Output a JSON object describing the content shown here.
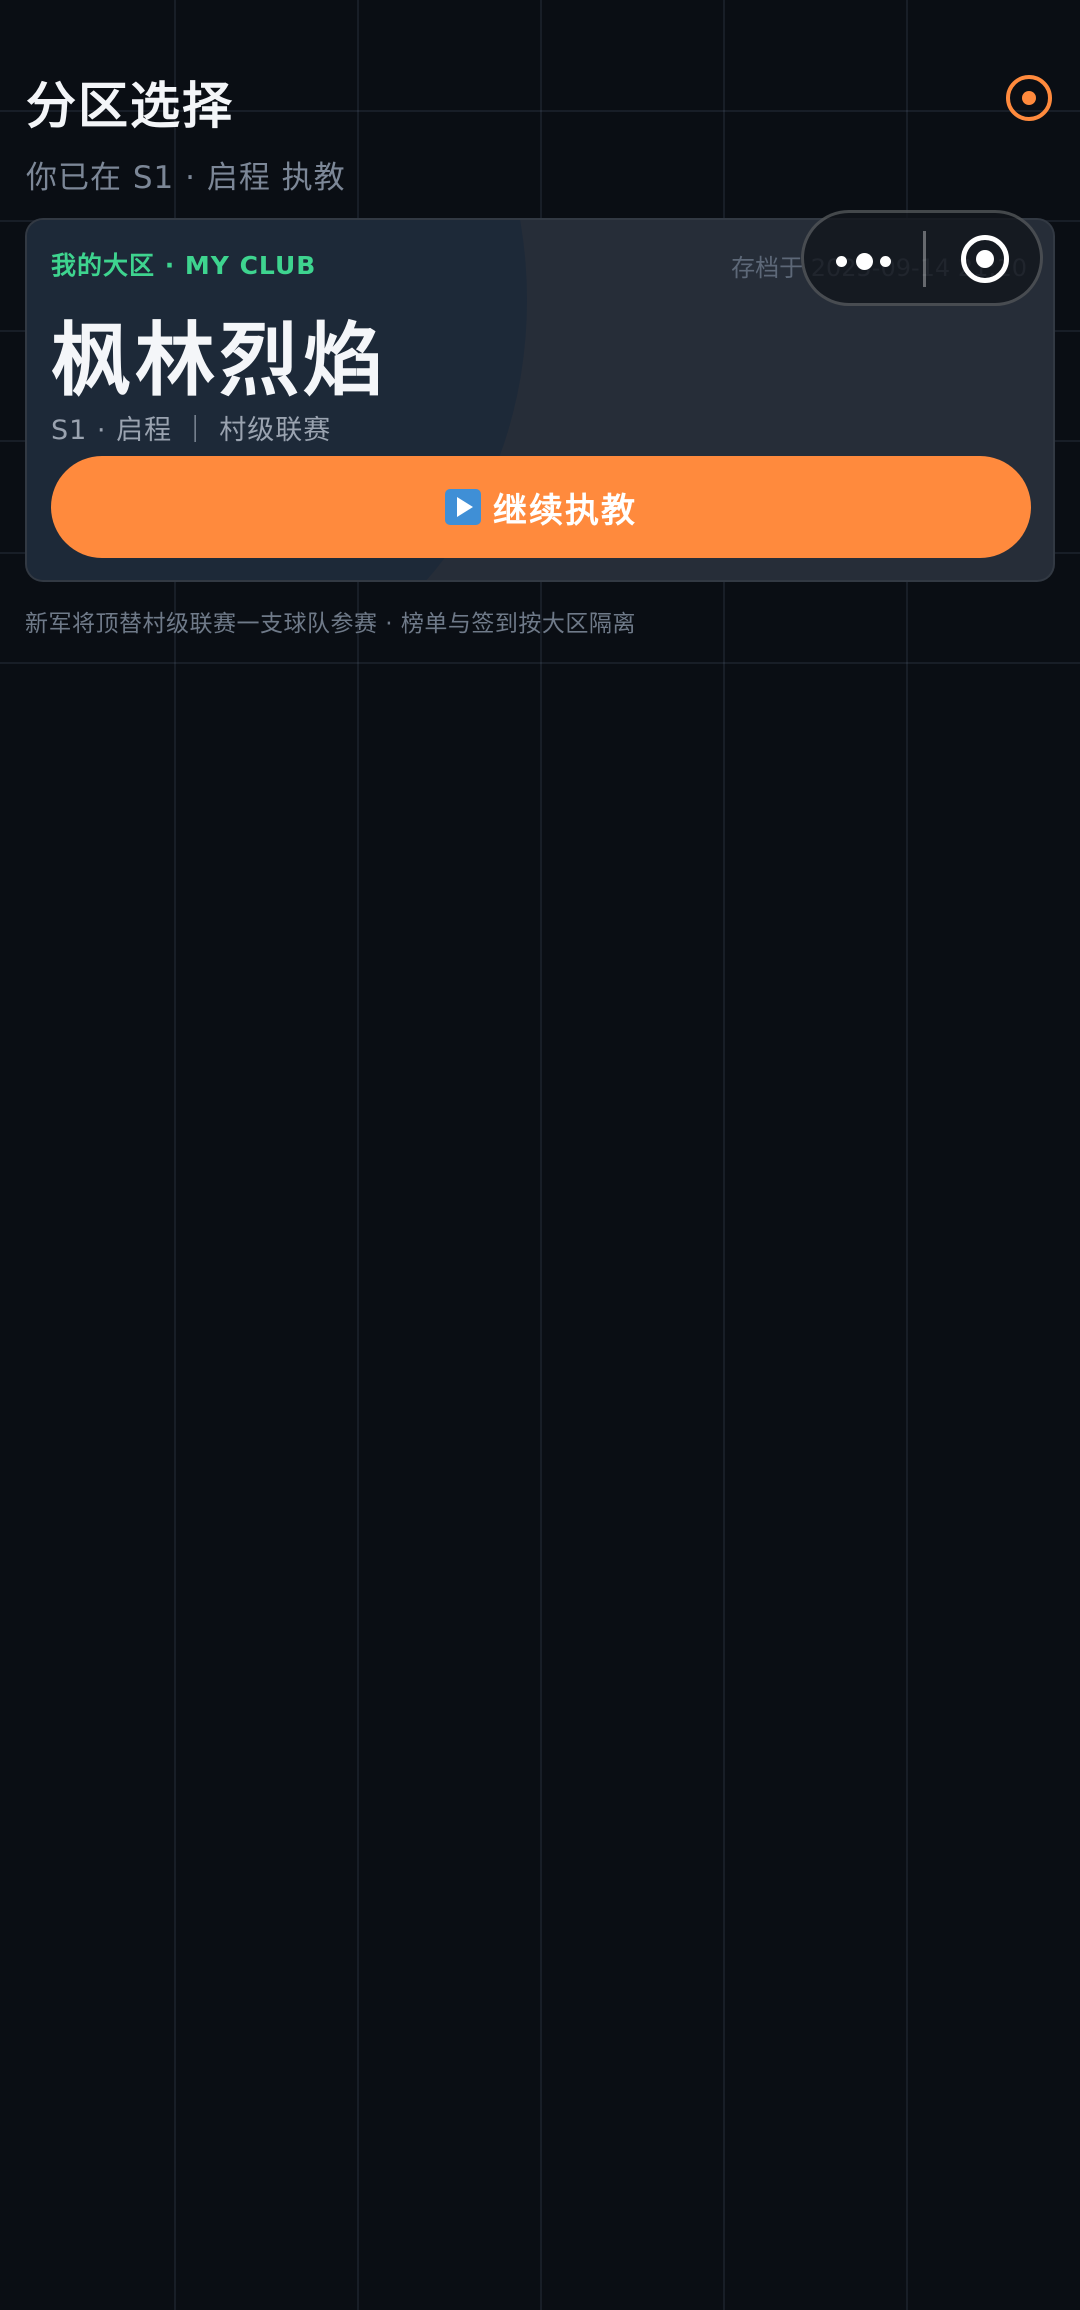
{
  "header": {
    "title": "分区选择",
    "subtitle": "你已在 S1 · 启程 执教"
  },
  "card": {
    "label": "我的大区 · MY CLUB",
    "save_time": "存档于 2025-09-14 21:10",
    "club_name": "枫林烈焰",
    "meta": "S1 · 启程 ｜ 村级联赛",
    "continue_label": "继续执教",
    "continue_icon": "play-icon"
  },
  "footnote": "新军将顶替村级联赛一支球队参赛 · 榜单与签到按大区隔离",
  "capsule": {
    "more_icon": "more-dots-icon",
    "close_icon": "target-close-icon"
  },
  "colors": {
    "background": "#0a0e14",
    "accent": "#ff8a3d",
    "label_green": "#3ed48f",
    "card": "#262d38"
  }
}
